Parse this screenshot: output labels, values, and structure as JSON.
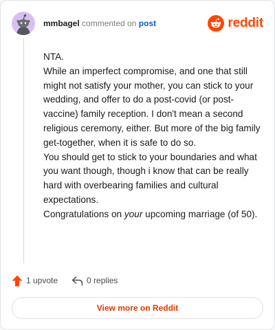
{
  "header": {
    "username": "mmbagel",
    "action_text": "commented on",
    "link_text": "post",
    "logo_text": "reddit"
  },
  "comment": {
    "paragraphs": [
      "NTA.",
      "While an imperfect compromise, and one that still might not satisfy your mother, you can stick to your wedding, and offer to do a post-covid (or post-vaccine) family reception. I don't mean a second religious ceremony, either. But more of the big family get-together, when it is safe to do so.",
      "You should get to stick to your boundaries and what you want though, though i know that can be really hard with overbearing families and cultural expectations."
    ],
    "last_prefix": "Congratulations on",
    "last_emphasis": "your",
    "last_suffix": "upcoming marriage (of 50)."
  },
  "actions": {
    "upvotes": "1 upvote",
    "replies": "0 replies"
  },
  "footer": {
    "view_more_label": "View more on Reddit"
  },
  "colors": {
    "accent": "#ff4500",
    "link": "#0a5bc2",
    "button_text": "#d93a00",
    "avatar_bg": "#d8bff2"
  },
  "icons": {
    "avatar": "snoo-avatar-icon",
    "logo": "reddit-logo-icon",
    "upvote": "upvote-arrow-icon",
    "reply": "reply-arrow-icon"
  }
}
